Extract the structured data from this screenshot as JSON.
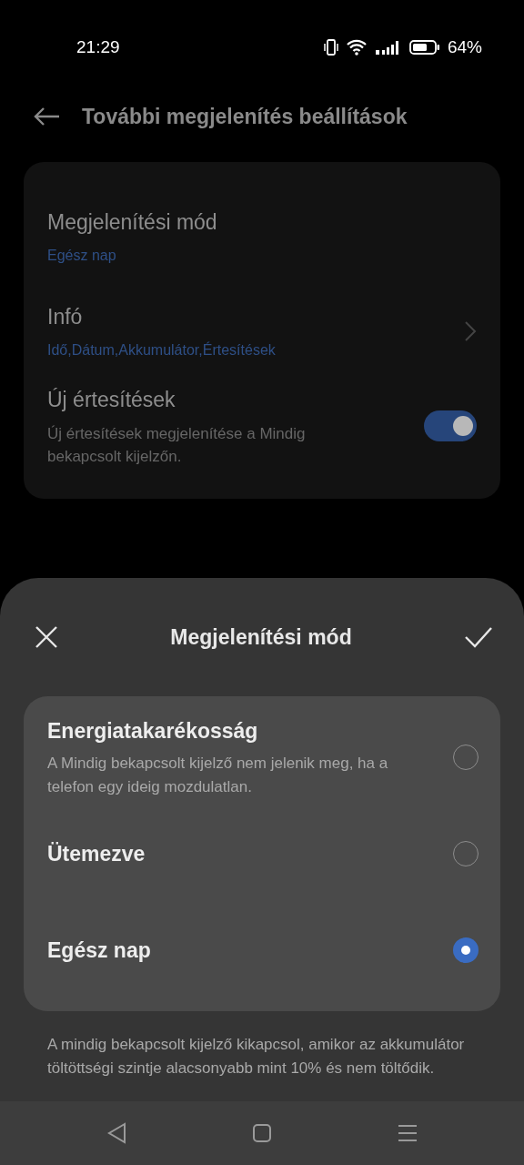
{
  "status_bar": {
    "time": "21:29",
    "battery": "64%"
  },
  "header": {
    "title": "További megjelenítés beállítások"
  },
  "settings": [
    {
      "kind": "value",
      "title": "Megjelenítési mód",
      "value": "Egész nap"
    },
    {
      "kind": "link",
      "title": "Infó",
      "value": "Idő,Dátum,Akkumulátor,Értesítések"
    },
    {
      "kind": "toggle",
      "title": "Új értesítések",
      "description": "Új értesítések megjelenítése a Mindig bekapcsolt kijelzőn.",
      "on": true
    }
  ],
  "sheet": {
    "title": "Megjelenítési mód",
    "options": [
      {
        "title": "Energiatakarékosság",
        "description": "A Mindig bekapcsolt kijelző nem jelenik meg, ha a telefon egy ideig mozdulatlan.",
        "selected": false
      },
      {
        "title": "Ütemezve",
        "selected": false
      },
      {
        "title": "Egész nap",
        "selected": true
      }
    ],
    "note": "A mindig bekapcsolt kijelző kikapcsol, amikor az akkumulátor töltöttségi szintje alacsonyabb mint 10% és nem töltődik."
  }
}
